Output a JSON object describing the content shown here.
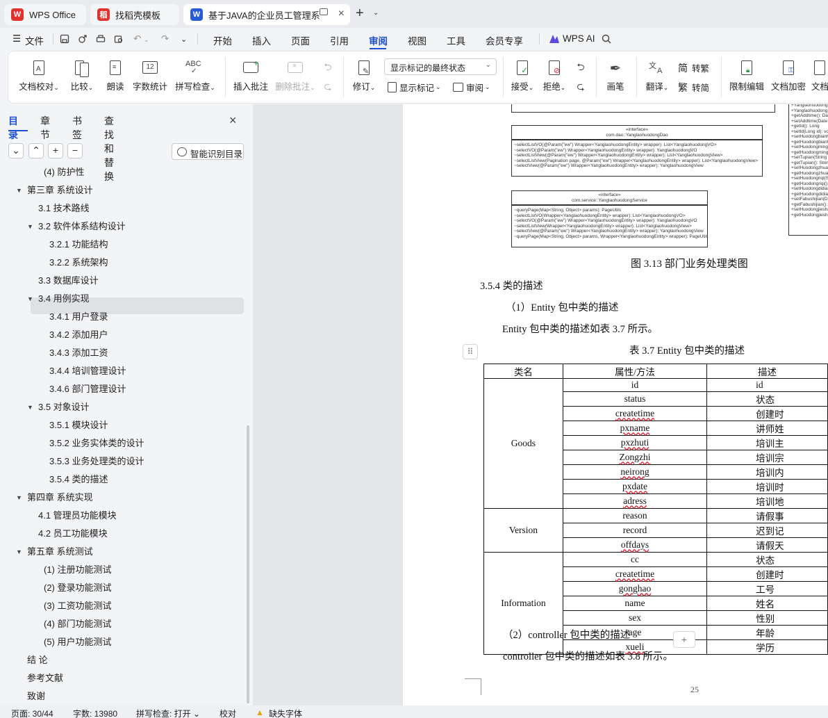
{
  "tabs": [
    {
      "label": "WPS Office",
      "icon": "wps-logo-icon",
      "color": "#e0322e"
    },
    {
      "label": "找稻壳模板",
      "icon": "docer-logo-icon",
      "color": "#e0322e"
    },
    {
      "label": "基于JAVA的企业员工管理系统",
      "icon": "wps-writer-icon",
      "color": "#2a5bd7"
    }
  ],
  "menu": {
    "file": "文件",
    "items": [
      "开始",
      "插入",
      "页面",
      "引用",
      "审阅",
      "视图",
      "工具",
      "会员专享"
    ],
    "active": "审阅",
    "ai": "WPS AI",
    "accent": "#1f4fd6"
  },
  "ribbon": {
    "doc_check": "文档校对",
    "compare": "比较",
    "read_aloud": "朗读",
    "word_count": "字数统计",
    "spell_check": "拼写检查",
    "insert_comment": "插入批注",
    "delete_comment": "删除批注",
    "revise": "修订",
    "markup_select": "显示标记的最终状态",
    "show_markup": "显示标记",
    "review": "审阅",
    "accept": "接受",
    "reject": "拒绝",
    "pen": "画笔",
    "translate": "翻译",
    "to_traditional": "转繁",
    "to_simplified": "转简",
    "restrict_edit": "限制编辑",
    "doc_encrypt": "文档加密",
    "doc_more": "文档"
  },
  "sidebar": {
    "tabs": [
      "目录",
      "章节",
      "书签",
      "查找和替换"
    ],
    "smart_toc": "智能识别目录",
    "toc": [
      {
        "label": "(4) 防护性",
        "level": 3,
        "arrow": false
      },
      {
        "label": "第三章  系统设计",
        "level": 1,
        "arrow": true
      },
      {
        "label": "3.1  技术路线",
        "level": 2,
        "arrow": false
      },
      {
        "label": "3.2  软件体系结构设计",
        "level": 2,
        "arrow": true
      },
      {
        "label": "3.2.1  功能结构",
        "level": 3,
        "arrow": false,
        "selected": true
      },
      {
        "label": "3.2.2  系统架构",
        "level": 3,
        "arrow": false
      },
      {
        "label": "3.3  数据库设计",
        "level": 2,
        "arrow": false
      },
      {
        "label": "3.4  用例实现",
        "level": 2,
        "arrow": true
      },
      {
        "label": "3.4.1  用户登录",
        "level": 3,
        "arrow": false
      },
      {
        "label": "3.4.2  添加用户",
        "level": 3,
        "arrow": false
      },
      {
        "label": "3.4.3  添加工资",
        "level": 3,
        "arrow": false
      },
      {
        "label": "3.4.4 培训管理设计",
        "level": 3,
        "arrow": false
      },
      {
        "label": "3.4.6 部门管理设计",
        "level": 3,
        "arrow": false
      },
      {
        "label": "3.5  对象设计",
        "level": 2,
        "arrow": true
      },
      {
        "label": "3.5.1  模块设计",
        "level": 3,
        "arrow": false
      },
      {
        "label": "3.5.2  业务实体类的设计",
        "level": 3,
        "arrow": false
      },
      {
        "label": "3.5.3  业务处理类的设计",
        "level": 3,
        "arrow": false
      },
      {
        "label": "3.5.4  类的描述",
        "level": 3,
        "arrow": false
      },
      {
        "label": "第四章  系统实现",
        "level": 1,
        "arrow": true
      },
      {
        "label": "4.1  管理员功能模块",
        "level": 2,
        "arrow": false
      },
      {
        "label": "4.2  员工功能模块",
        "level": 2,
        "arrow": false
      },
      {
        "label": "第五章  系统测试",
        "level": 1,
        "arrow": true
      },
      {
        "label": "(1) 注册功能测试",
        "level": 3,
        "arrow": false
      },
      {
        "label": "(2) 登录功能测试",
        "level": 3,
        "arrow": false
      },
      {
        "label": "(3) 工资功能测试",
        "level": 3,
        "arrow": false
      },
      {
        "label": "(4) 部门功能测试",
        "level": 3,
        "arrow": false
      },
      {
        "label": "(5) 用户功能测试",
        "level": 3,
        "arrow": false
      },
      {
        "label": "结  论",
        "level": 1,
        "arrow": false
      },
      {
        "label": "参考文献",
        "level": 1,
        "arrow": false
      },
      {
        "label": "致谢",
        "level": 1,
        "arrow": false
      }
    ]
  },
  "document": {
    "uml_dao": {
      "stereotype": "«interface»",
      "name": "com.dao::YanglaohuodongDao",
      "methods": [
        "~selectListVO(@Param(\"ew\") Wrapper<YanglaohuodongEntity> wrapper): List<YanglaohuodongVO>",
        "~selectVO(@Param(\"ew\") Wrapper<YanglaohuodongEntity> wrapper): YanglaohuodongVO",
        "~selectListView(@Param(\"ew\") Wrapper<YanglaohuodongEntity> wrapper): List<YanglaohuodongView>",
        "~selectListView(Pagination page, @Param(\"ew\") Wrapper<YanglaohuodongEntity> wrapper): List<YanglaohuodongView>",
        "~selectView(@Param(\"ew\") Wrapper<YanglaohuodongEntity> wrapper): YanglaohuodongView"
      ]
    },
    "uml_service": {
      "stereotype": "«interface»",
      "name": "com.service::YanglaohuodongService",
      "methods": [
        "~queryPage(Map<String, Object> params): PageUtils",
        "~selectListVO(Wrapper<YanglaohuodongEntity> wrapper): List<YanglaohuodongVO>",
        "~selectVO(@Param(\"ew\") Wrapper<YanglaohuodongEntity> wrapper): YanglaohuodongVO",
        "~selectListView(Wrapper<YanglaohuodongEntity> wrapper): List<YanglaohuodongView>",
        "~selectView(@Param(\"ew\") Wrapper<YanglaohuodongEntity> wrapper): YanglaohuodongView",
        "~queryPage(Map<String, Object> params, Wrapper<YanglaohuodongEntity> wrapper): PageUtils"
      ]
    },
    "uml_entity_methods": [
      "+Yanglaohuodong",
      "+YanglaohuodongE",
      "+getAddtime(): Dat",
      "+setAddtime(Date a",
      "+getId(): Long",
      "+setId(Long id): vo",
      "+setHuodongbianh",
      "+getHuodongbianh",
      "+setHuodongmingc",
      "+getHuodongmingc",
      "+setTupian(String t",
      "+getTupian(): String",
      "+setHuodongzhuan",
      "+getHuodongzhuan",
      "+setHuodongriqi(St",
      "+getHuodongriqi():",
      "+setHuodongdidian",
      "+getHuodongdidian",
      "+setFabushijian(Da",
      "+getFabushijian():",
      "+setHuodongjiesha",
      "+getHuodongjiesha"
    ],
    "figure_caption": "图 3.13  部门业务处理类图",
    "section_title": "3.5.4  类的描述",
    "sub1": "（1）Entity 包中类的描述",
    "para1": "Entity 包中类的描述如表 3.7 所示。",
    "table_caption": "表 3.7 Entity  包中类的描述",
    "table": {
      "headers": [
        "类名",
        "属性/方法",
        "描述"
      ],
      "groups": [
        {
          "name": "Goods",
          "rows": [
            {
              "attr": "id",
              "desc": "id",
              "wavy": false
            },
            {
              "attr": "status",
              "desc": "状态",
              "wavy": false
            },
            {
              "attr": "createtime",
              "desc": "创建时",
              "wavy": true
            },
            {
              "attr": "pxname",
              "desc": "讲师姓",
              "wavy": true
            },
            {
              "attr": "pxzhuti",
              "desc": "培训主",
              "wavy": true
            },
            {
              "attr": "Zongzhi",
              "desc": "培训宗",
              "wavy": true
            },
            {
              "attr": "neirong",
              "desc": "培训内",
              "wavy": true
            },
            {
              "attr": "pxdate",
              "desc": "培训时",
              "wavy": true
            },
            {
              "attr": "adress",
              "desc": "培训地",
              "wavy": true
            }
          ]
        },
        {
          "name": "Version",
          "rows": [
            {
              "attr": "reason",
              "desc": "请假事",
              "wavy": false
            },
            {
              "attr": "record",
              "desc": "迟到记",
              "wavy": false
            },
            {
              "attr": "offdays",
              "desc": "请假天",
              "wavy": true
            }
          ]
        },
        {
          "name": "Information",
          "rows": [
            {
              "attr": "cc",
              "desc": "状态",
              "wavy": false
            },
            {
              "attr": "createtime",
              "desc": "创建时",
              "wavy": true
            },
            {
              "attr": "gonghao",
              "desc": "工号",
              "wavy": true
            },
            {
              "attr": "name",
              "desc": "姓名",
              "wavy": false
            },
            {
              "attr": "sex",
              "desc": "性别",
              "wavy": false
            },
            {
              "attr": "age",
              "desc": "年龄",
              "wavy": false
            },
            {
              "attr": "xueli",
              "desc": "学历",
              "wavy": true
            }
          ]
        }
      ]
    },
    "sub2": "（2）controller 包中类的描述",
    "para2": "controller 包中类的描述如表 3.8 所示。",
    "page_number": "25"
  },
  "status": {
    "page": "页面: 30/44",
    "words": "字数: 13980",
    "spell": "拼写检查: 打开",
    "proof": "校对",
    "missing_font": "缺失字体",
    "warn_color": "#e8a400"
  }
}
